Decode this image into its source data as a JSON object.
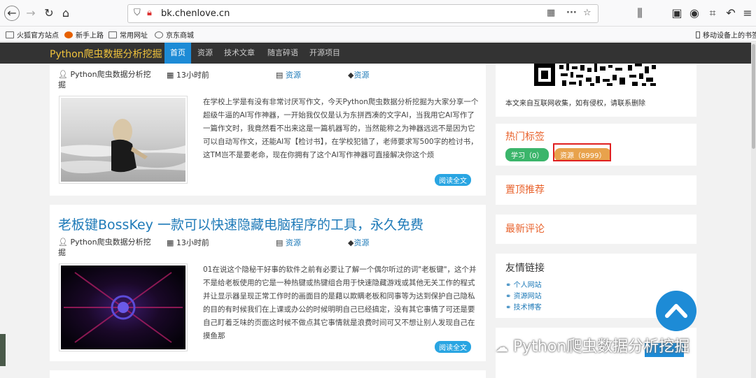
{
  "browser": {
    "url": "bk.chenlove.cn",
    "bookmarks": [
      "火狐官方站点",
      "新手上路",
      "常用网址",
      "京东商城"
    ],
    "mobile_bookmarks": "移动设备上的书签"
  },
  "site": {
    "title": "Python爬虫数据分析挖掘",
    "nav": [
      "首页",
      "资源",
      "技术文章",
      "随言碎语",
      "开源项目"
    ]
  },
  "posts": [
    {
      "author": "Python爬虫数据分析挖掘",
      "time": "13小时前",
      "category": "资源",
      "tag": "资源",
      "excerpt": "在学校上学是有没有非常讨厌写作文，今天Python爬虫数据分析挖掘为大家分享一个超级牛逼的AI写作神器，一开始我仅仅是认为东拼西凑的文字AI，当我用它AI写作了一篇作文时，我竟然看不出来这是一篇机器写的，当然能称之为神器远远不是因为它可以自动写作文，还能AI写【检讨书】，在学校犯错了，老师要求写500字的检讨书，这TM岂不是要老命，现在你拥有了这个AI写作神器可直接解决你这个烦",
      "read_more": "阅读全文"
    },
    {
      "title": "老板键BossKey 一款可以快速隐藏电脑程序的工具，永久免费",
      "author": "Python爬虫数据分析挖掘",
      "time": "13小时前",
      "category": "资源",
      "tag": "资源",
      "excerpt": "01在说这个隐秘干好事的软件之前有必要让了解一个偶尔听过的词\"老板键\"，这个并不是给老板使用的它是一种热键或热键组合用于快速隐藏游戏或其他无关工作的程式并让显示器呈现正常工作时的画面目的是藉以欺瞒老板和同事等为达到保护自己隐私的目的有时候我们在上课或办公的时候明明自己已经搞定，没有其它事情了可还是要自己盯着乏味的页面这时候不做点其它事情就是浪费时间可又不想让别人发现自己在摸鱼那",
      "read_more": "阅读全文"
    }
  ],
  "sidebar": {
    "notice": "本文来自互联网收集，如有侵权，请联系删除",
    "hot_tags_title": "热门标签",
    "tags": [
      {
        "label": "学习（0）",
        "color": "#3bb56b"
      },
      {
        "label": "资源（8999）",
        "color": "#e8a24c"
      }
    ],
    "pinned_title": "置顶推荐",
    "comments_title": "最新评论",
    "links_title": "友情链接",
    "links": [
      "个人网站",
      "资源网站",
      "技术博客"
    ]
  },
  "watermark": "Python爬虫数据分析挖掘",
  "colors": {
    "accent": "#1d8bd6",
    "title_orange": "#e8622c",
    "nav_bg": "#333333"
  }
}
